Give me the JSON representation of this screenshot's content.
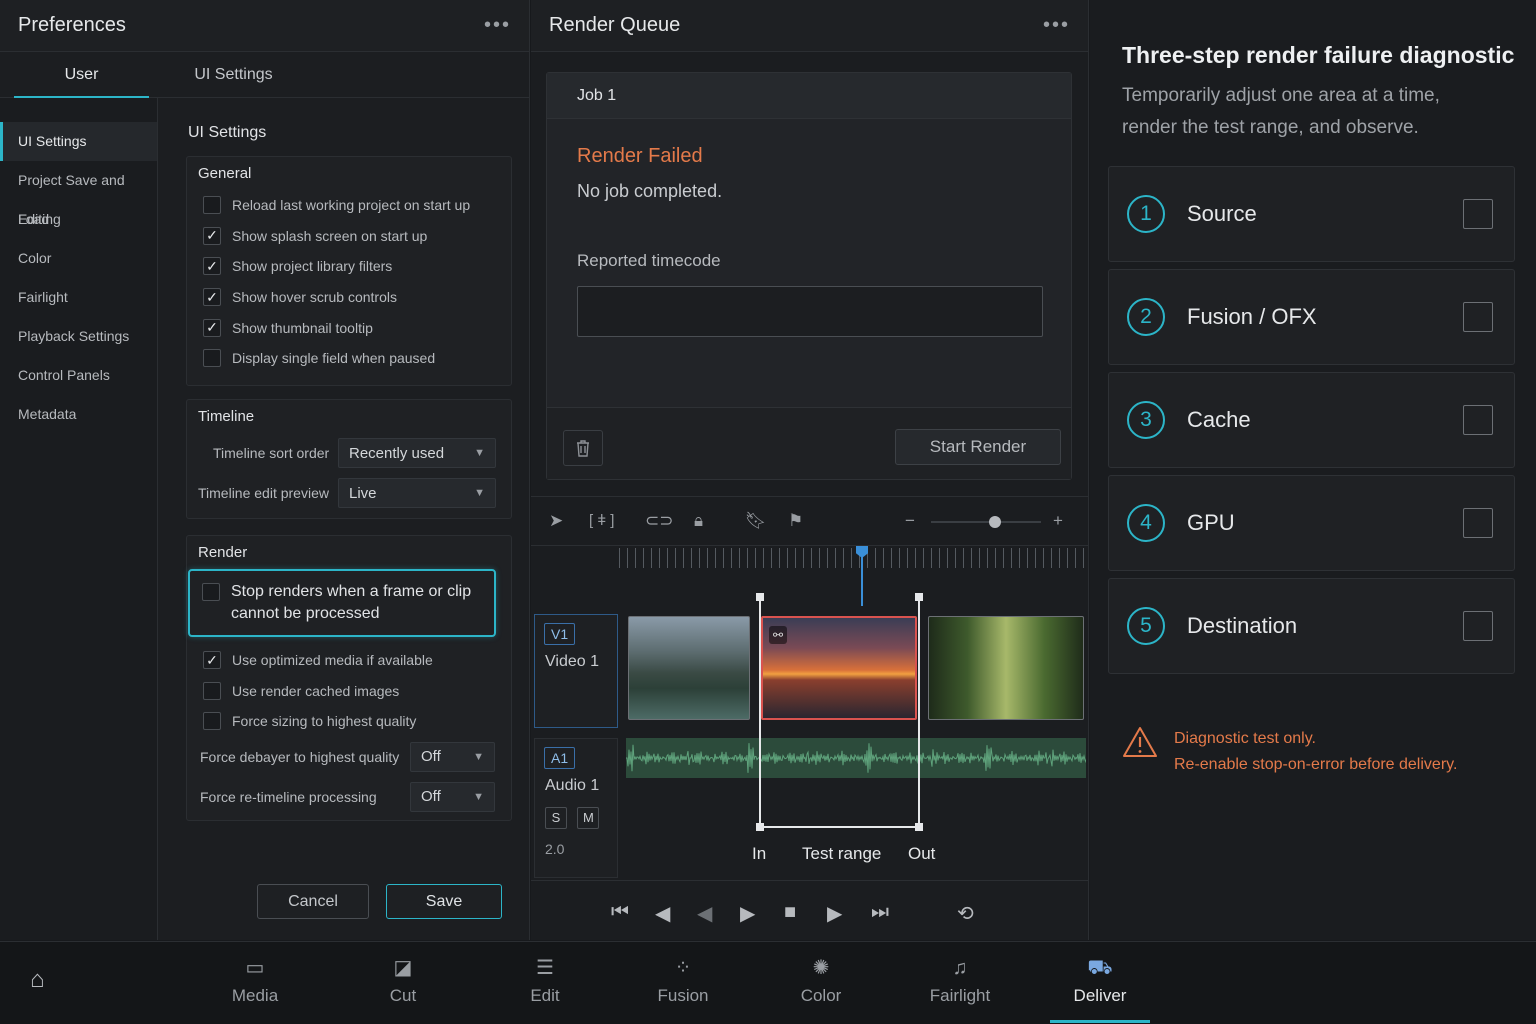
{
  "preferences": {
    "title": "Preferences",
    "tabs": [
      "User",
      "UI Settings"
    ],
    "nav": [
      "UI Settings",
      "Project Save and Load",
      "Editing",
      "Color",
      "Fairlight",
      "Playback Settings",
      "Control Panels",
      "Metadata"
    ],
    "section_title": "UI Settings",
    "general": {
      "title": "General",
      "items": [
        {
          "label": "Reload last working project on start up",
          "checked": false
        },
        {
          "label": "Show splash screen on start up",
          "checked": true
        },
        {
          "label": "Show project library filters",
          "checked": true
        },
        {
          "label": "Show hover scrub controls",
          "checked": true
        },
        {
          "label": "Show thumbnail tooltip",
          "checked": true
        },
        {
          "label": "Display single field when paused",
          "checked": false
        }
      ]
    },
    "timeline": {
      "title": "Timeline",
      "sort_label": "Timeline sort order",
      "sort_value": "Recently used",
      "preview_label": "Timeline edit preview",
      "preview_value": "Live"
    },
    "render": {
      "title": "Render",
      "highlight": {
        "label": "Stop renders when a frame or clip cannot be processed",
        "checked": false
      },
      "items": [
        {
          "label": "Use optimized media if available",
          "checked": true
        },
        {
          "label": "Use render cached images",
          "checked": false
        },
        {
          "label": "Force sizing to highest quality",
          "checked": false
        }
      ],
      "debayer_label": "Force debayer to highest quality",
      "debayer_value": "Off",
      "retimeline_label": "Force re-timeline processing",
      "retimeline_value": "Off"
    },
    "cancel_label": "Cancel",
    "save_label": "Save"
  },
  "render_queue": {
    "title": "Render Queue",
    "job": {
      "name": "Job 1",
      "status": "Render Failed",
      "message": "No job completed.",
      "timecode_label": "Reported timecode",
      "timecode_value": ""
    },
    "start_label": "Start Render"
  },
  "timeline_view": {
    "video_tag": "V1",
    "video_name": "Video 1",
    "audio_tag": "A1",
    "audio_name": "Audio 1",
    "solo": "S",
    "mute": "M",
    "channels": "2.0",
    "in_label": "In",
    "range_label": "Test range",
    "out_label": "Out"
  },
  "diagnostic": {
    "title": "Three-step render failure diagnostic",
    "subtitle": "Temporarily adjust one area at a time, render the test range, and observe.",
    "steps": [
      {
        "num": "1",
        "label": "Source"
      },
      {
        "num": "2",
        "label": "Fusion / OFX"
      },
      {
        "num": "3",
        "label": "Cache"
      },
      {
        "num": "4",
        "label": "GPU"
      },
      {
        "num": "5",
        "label": "Destination"
      }
    ],
    "warning_line1": "Diagnostic test only.",
    "warning_line2": "Re-enable stop-on-error before delivery."
  },
  "pages": [
    "Media",
    "Cut",
    "Edit",
    "Fusion",
    "Color",
    "Fairlight",
    "Deliver"
  ],
  "active_page": "Deliver",
  "colors": {
    "accent": "#2cb5c8",
    "error": "#e47a4a",
    "selected_clip": "#d9534f"
  }
}
